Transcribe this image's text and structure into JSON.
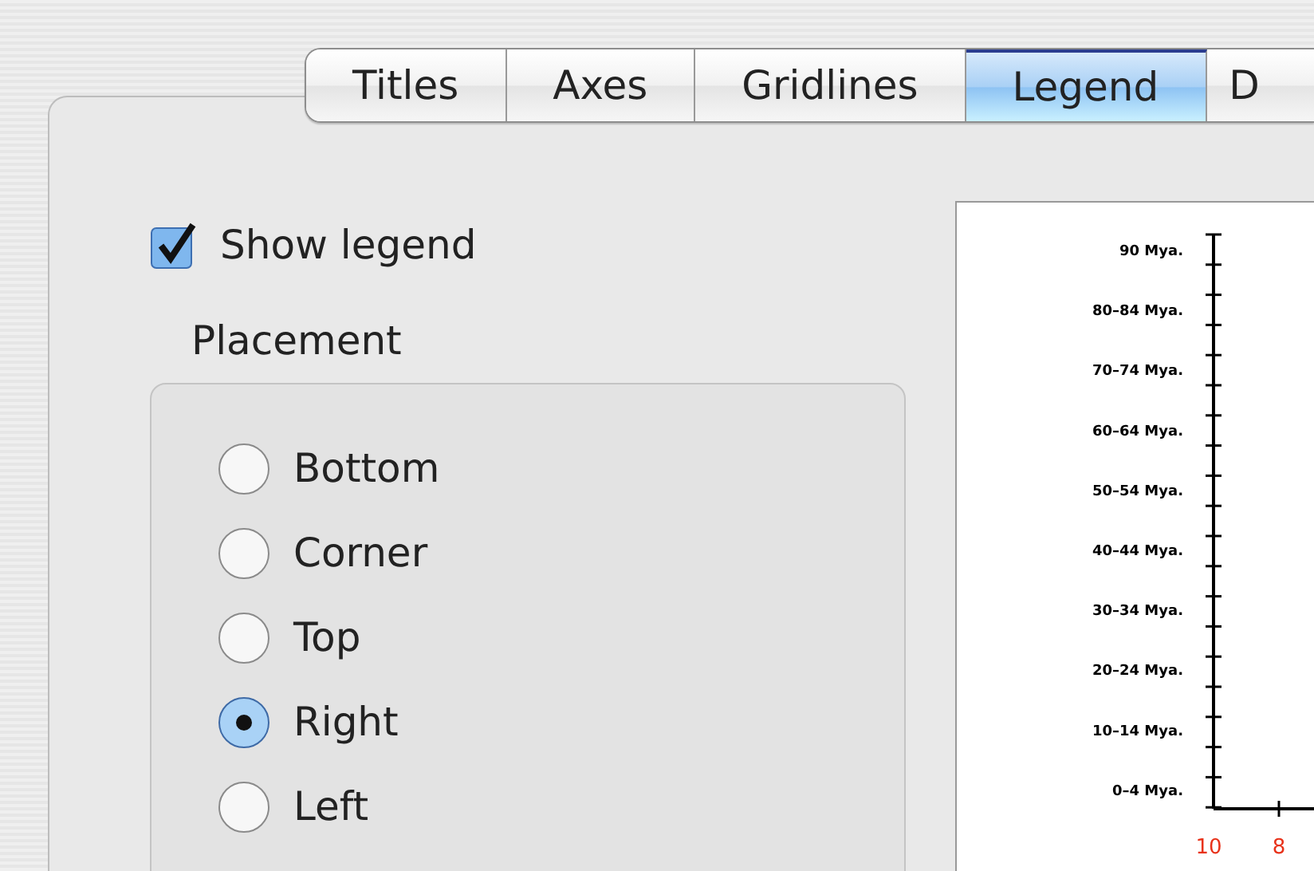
{
  "tabs": [
    {
      "label": "Titles",
      "selected": false
    },
    {
      "label": "Axes",
      "selected": false
    },
    {
      "label": "Gridlines",
      "selected": false
    },
    {
      "label": "Legend",
      "selected": true
    },
    {
      "label": "D",
      "selected": false
    }
  ],
  "show_legend": {
    "label": "Show legend",
    "checked": true
  },
  "placement": {
    "title": "Placement",
    "options": [
      {
        "label": "Bottom",
        "selected": false
      },
      {
        "label": "Corner",
        "selected": false
      },
      {
        "label": "Top",
        "selected": false
      },
      {
        "label": "Right",
        "selected": true
      },
      {
        "label": "Left",
        "selected": false
      }
    ]
  },
  "preview": {
    "y_labels": [
      "90 Mya.",
      "80–84 Mya.",
      "70–74 Mya.",
      "60–64 Mya.",
      "50–54 Mya.",
      "40–44 Mya.",
      "30–34 Mya.",
      "20–24 Mya.",
      "10–14 Mya.",
      "0–4 Mya."
    ],
    "x_labels": [
      "10",
      "8"
    ]
  }
}
